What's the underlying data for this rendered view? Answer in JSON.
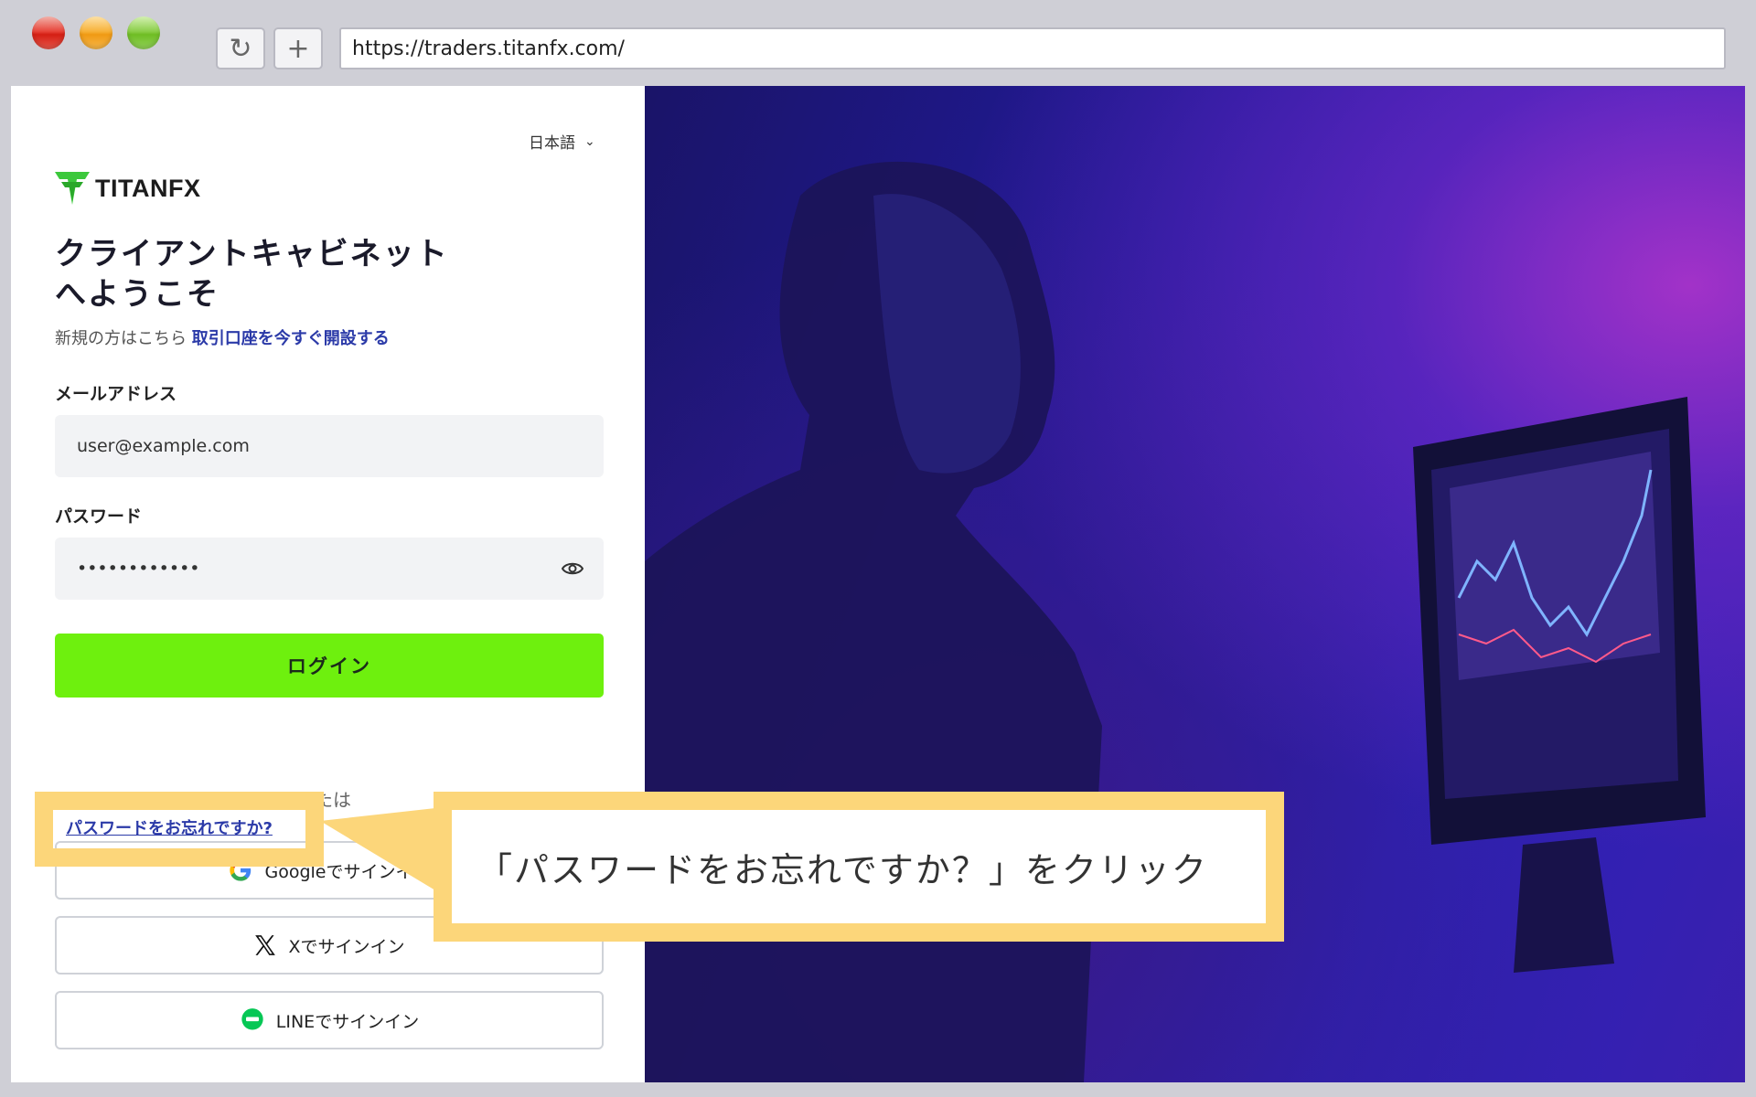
{
  "browser": {
    "url": "https://traders.titanfx.com/",
    "reload_icon": "↻",
    "newtab_icon": "+"
  },
  "header": {
    "language": "日本語",
    "language_chevron": "⌄"
  },
  "logo": {
    "text": "TITANFX"
  },
  "welcome": {
    "line1": "クライアントキャビネット",
    "line2": "へようこそ"
  },
  "signup": {
    "prefix": "新規の方はこちら",
    "link": "取引口座を今すぐ開設する"
  },
  "form": {
    "email_label": "メールアドレス",
    "email_value": "user@example.com",
    "password_label": "パスワード",
    "password_value": "••••••••••••",
    "login_button": "ログイン",
    "forgot_password": "パスワードをお忘れですか?",
    "or_text": "または"
  },
  "social": {
    "google": "Googleでサインイン",
    "x": "Xでサインイン",
    "line": "LINEでサインイン"
  },
  "callout": {
    "text": "「パスワードをお忘れですか？」をクリック"
  },
  "colors": {
    "accent_green": "#6ef00e",
    "link_blue": "#2b3aa8",
    "callout_yellow": "#fcd67a"
  }
}
